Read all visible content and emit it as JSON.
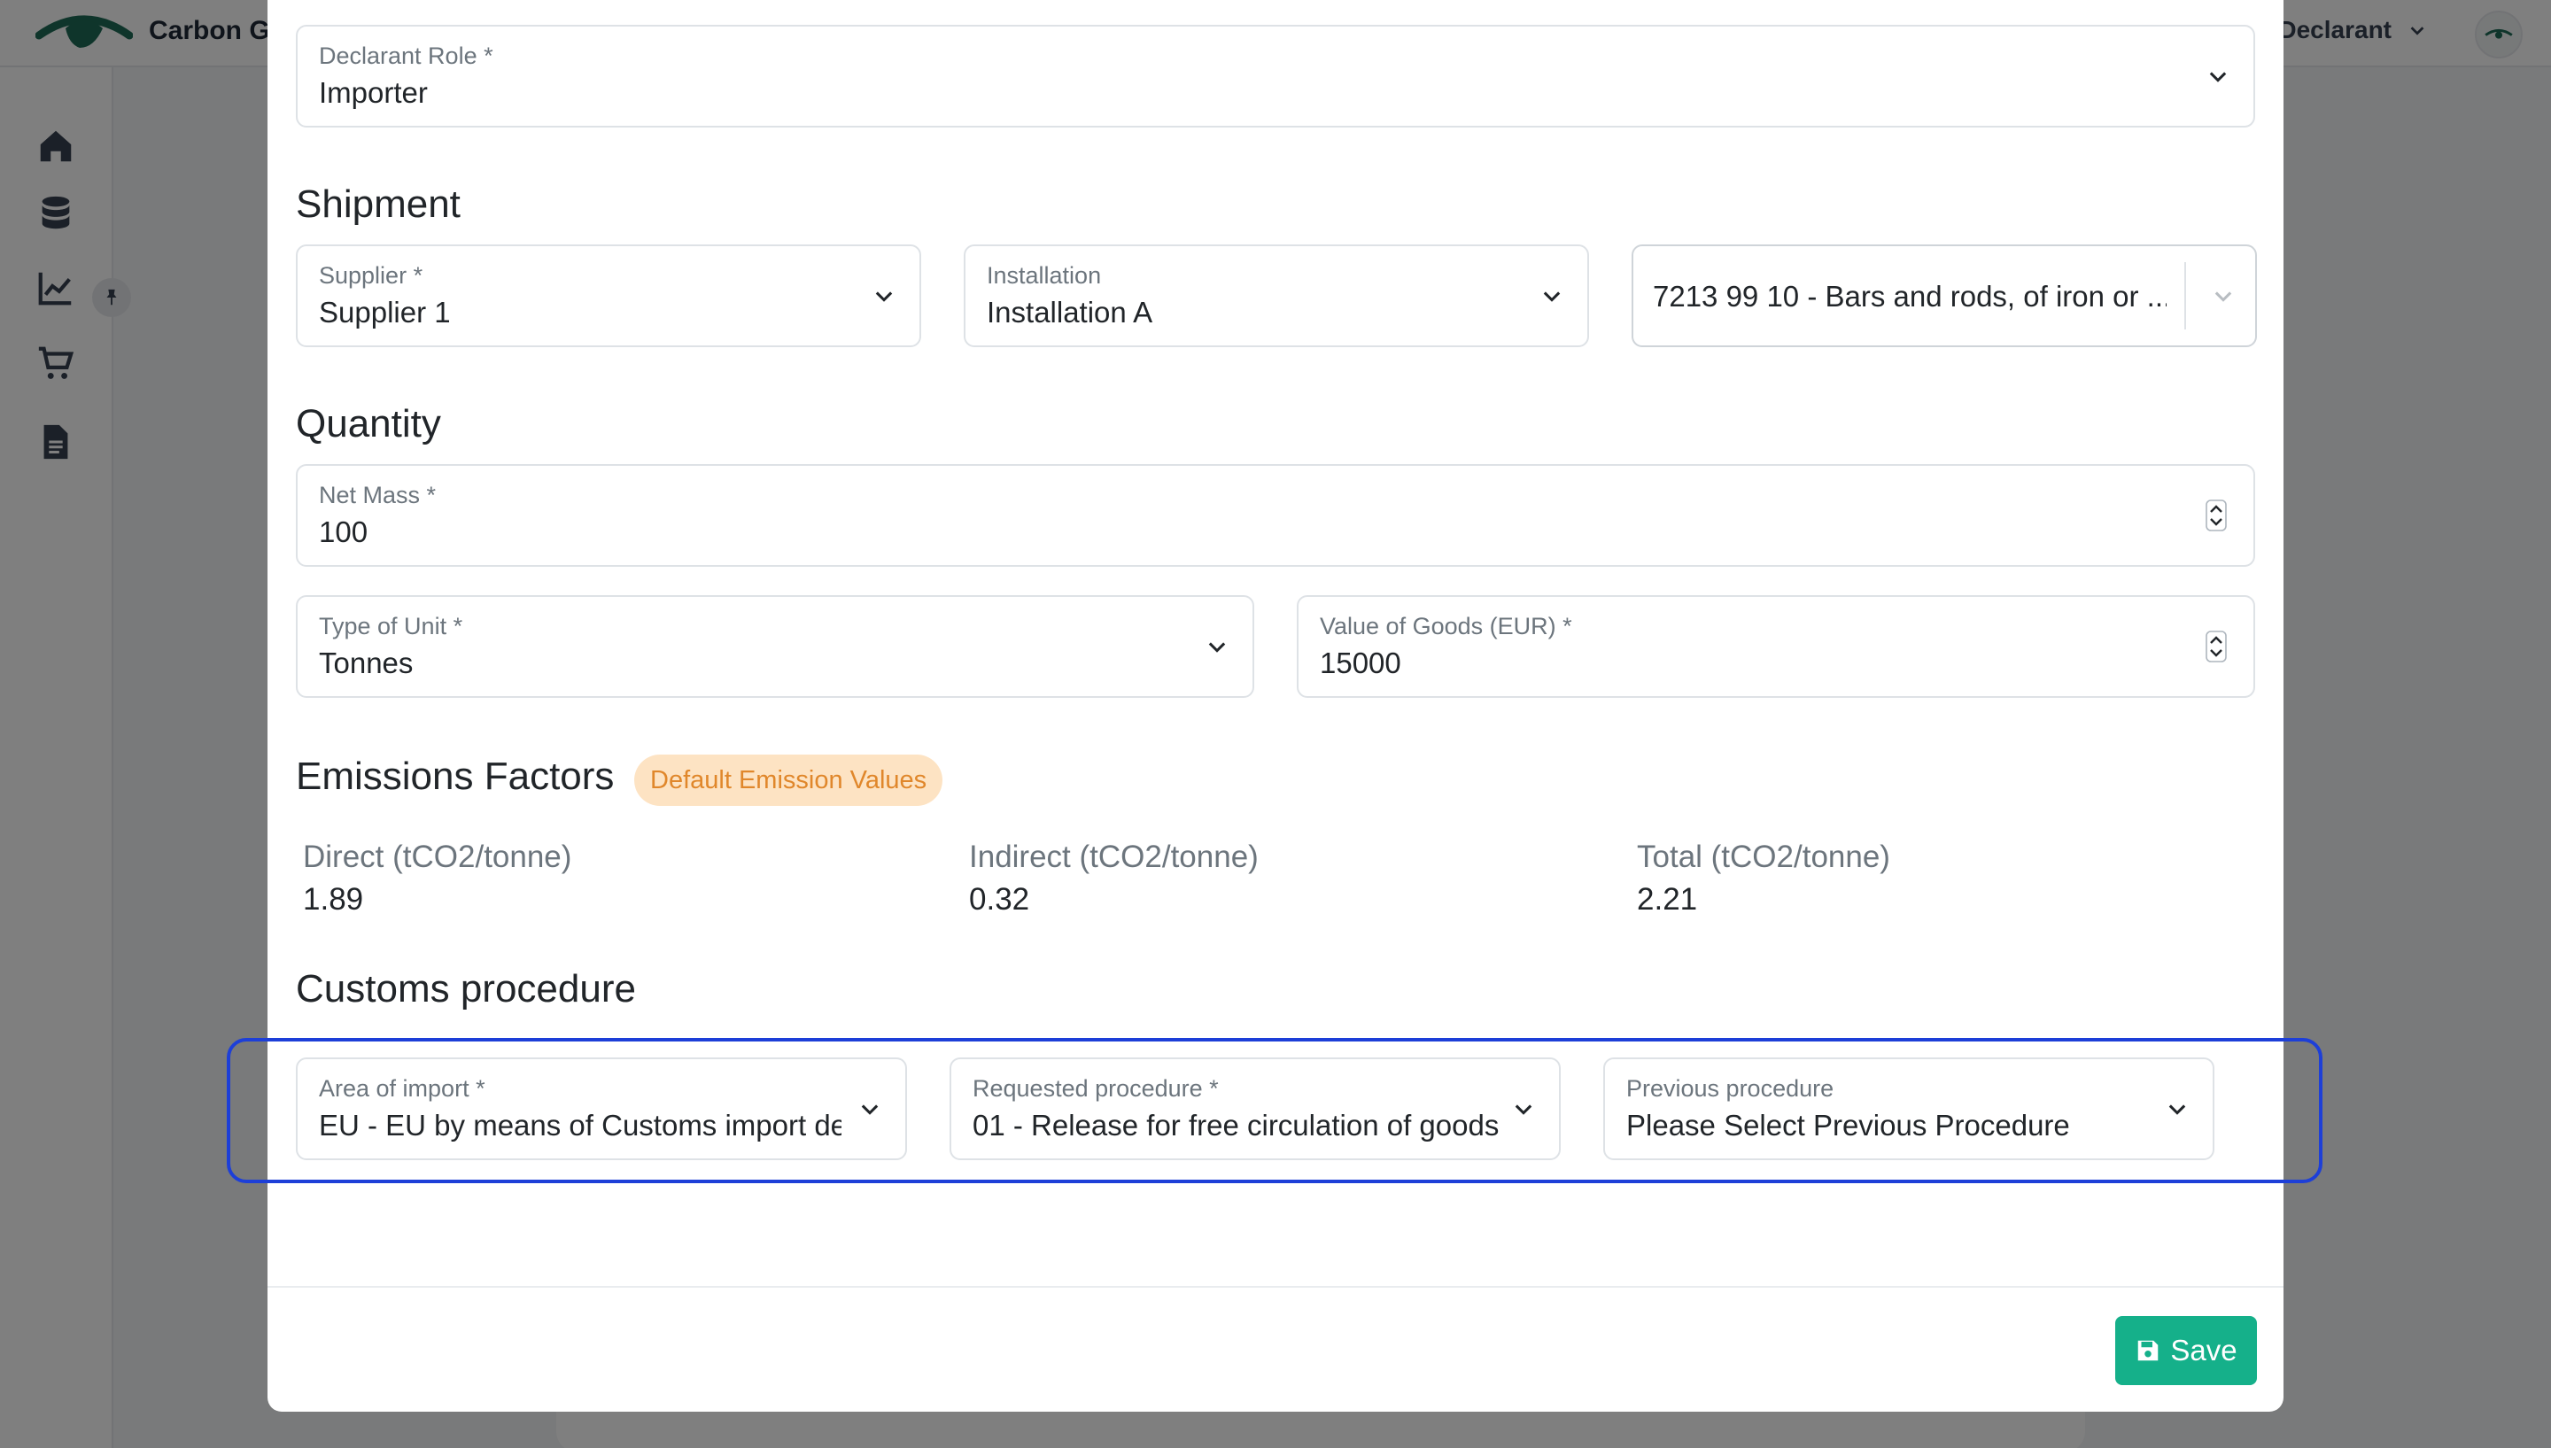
{
  "app": {
    "brand": "Carbon G",
    "user_role": "I Declarant"
  },
  "icons": {
    "logo": "eye-logo-icon",
    "sidebar": [
      "home-icon",
      "database-icon",
      "chart-line-icon",
      "cart-icon",
      "document-icon"
    ],
    "pin": "pin-icon",
    "user_chevron": "chevron-down-icon",
    "avatar": "eye-logo-icon"
  },
  "colors": {
    "brand_green": "#1f6b56",
    "save_button": "#15b08a",
    "badge_bg": "#fde3c3",
    "badge_text": "#e0872b",
    "highlight_border": "#1d3fd8"
  },
  "form": {
    "declarant_role": {
      "label": "Declarant Role *",
      "value": "Importer"
    },
    "shipment": {
      "title": "Shipment",
      "supplier": {
        "label": "Supplier *",
        "value": "Supplier 1"
      },
      "installation": {
        "label": "Installation",
        "value": "Installation A"
      },
      "cn_code": {
        "value": "7213 99 10 - Bars and rods, of iron or ..."
      }
    },
    "quantity": {
      "title": "Quantity",
      "net_mass": {
        "label": "Net Mass *",
        "value": "100"
      },
      "unit_type": {
        "label": "Type of Unit *",
        "value": "Tonnes"
      },
      "goods_value": {
        "label": "Value of Goods (EUR) *",
        "value": "15000"
      }
    },
    "emissions": {
      "title": "Emissions Factors",
      "badge": "Default Emission Values",
      "direct": {
        "label": "Direct (tCO2/tonne)",
        "value": "1.89"
      },
      "indirect": {
        "label": "Indirect (tCO2/tonne)",
        "value": "0.32"
      },
      "total": {
        "label": "Total (tCO2/tonne)",
        "value": "2.21"
      }
    },
    "customs": {
      "title": "Customs procedure",
      "area_of_import": {
        "label": "Area of import *",
        "value": "EU - EU by means of Customs import declaration"
      },
      "requested_procedure": {
        "label": "Requested procedure *",
        "value": "01 - Release for free circulation of goods"
      },
      "previous_procedure": {
        "label": "Previous procedure",
        "value": "Please Select Previous Procedure"
      }
    }
  },
  "actions": {
    "save_label": "Save"
  }
}
